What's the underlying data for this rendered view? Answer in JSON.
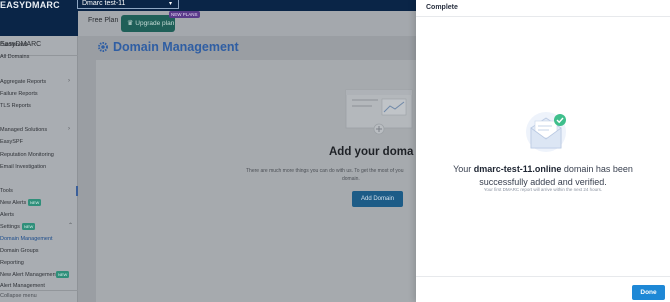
{
  "app": {
    "logo": "EASYDMARC"
  },
  "header": {
    "org_selector": "Dmarc test-11",
    "plan_label": "Free Plan",
    "upgrade_label": "Upgrade plan",
    "new_plans_badge": "NEW PLANS"
  },
  "sidebar": {
    "org_name": "EasyDMARC",
    "items": {
      "dashboard": "Dashboard",
      "all_domains": "All Domains",
      "aggregate_reports": "Aggregate Reports",
      "failure_reports": "Failure Reports",
      "tls_reports": "TLS Reports",
      "managed_solutions": "Managed Solutions",
      "easyspf": "EasySPF",
      "reputation_monitoring": "Reputation Monitoring",
      "email_investigation": "Email Investigation",
      "tools": "Tools",
      "new_alerts": "New Alerts",
      "alerts": "Alerts",
      "settings": "Settings",
      "domain_management": "Domain Management",
      "domain_groups": "Domain Groups",
      "reporting": "Reporting",
      "new_alert_management": "New Alert Management",
      "alert_management": "Alert Management"
    },
    "badges": {
      "new_alerts": "NEW",
      "settings": "NEW",
      "new_alert_management": "NEW"
    },
    "collapse_label": "Collapse menu"
  },
  "main": {
    "page_title": "Domain Management",
    "empty_title": "Add your doma",
    "empty_text": "There are much more things you can do with us. To get the most of you",
    "empty_text2": "domain.",
    "add_domain_label": "Add Domain"
  },
  "drawer": {
    "title": "Complete",
    "success_prefix": "Your ",
    "success_domain": "dmarc-test-11.online",
    "success_suffix": " domain has been",
    "success_line2": "successfully added and verified.",
    "sub_text": "Your first DMARC report will arrive within the next 24 hours.",
    "done_label": "Done"
  },
  "colors": {
    "brand_navy": "#0a2547",
    "accent_blue": "#2f5ea3",
    "done_blue": "#1e88d6",
    "success_green": "#3fbf8c",
    "feedback_red": "#e24b4b"
  },
  "icons": [
    "gear-icon",
    "crown-icon",
    "chevron-down-icon",
    "envelope-check-icon",
    "domain-illustration-icon"
  ]
}
